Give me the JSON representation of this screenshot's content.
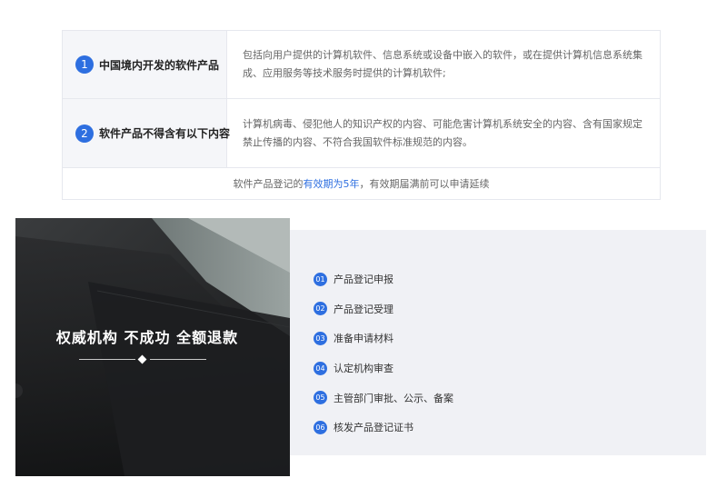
{
  "info_table": {
    "rows": [
      {
        "num": "1",
        "label": "中国境内开发的软件产品",
        "desc": "包括向用户提供的计算机软件、信息系统或设备中嵌入的软件，或在提供计算机信息系统集成、应用服务等技术服务时提供的计算机软件;"
      },
      {
        "num": "2",
        "label": "软件产品不得含有以下内容",
        "desc": "计算机病毒、侵犯他人的知识产权的内容、可能危害计算机系统安全的内容、含有国家规定禁止传播的内容、不符合我国软件标准规范的内容。"
      }
    ],
    "note_before": "软件产品登记的",
    "note_highlight": "有效期为5年",
    "note_after": "，有效期届满前可以申请延续"
  },
  "photo_panel": {
    "title": "权威机构 不成功 全额退款"
  },
  "steps": [
    {
      "num": "01",
      "label": "产品登记申报"
    },
    {
      "num": "02",
      "label": "产品登记受理"
    },
    {
      "num": "03",
      "label": "准备申请材料"
    },
    {
      "num": "04",
      "label": "认定机构审查"
    },
    {
      "num": "05",
      "label": "主管部门审批、公示、备案"
    },
    {
      "num": "06",
      "label": "核发产品登记证书"
    }
  ],
  "colors": {
    "accent": "#2e6fe0",
    "label_bg": "#f5f6f9",
    "steps_bg": "#f0f1f5"
  }
}
